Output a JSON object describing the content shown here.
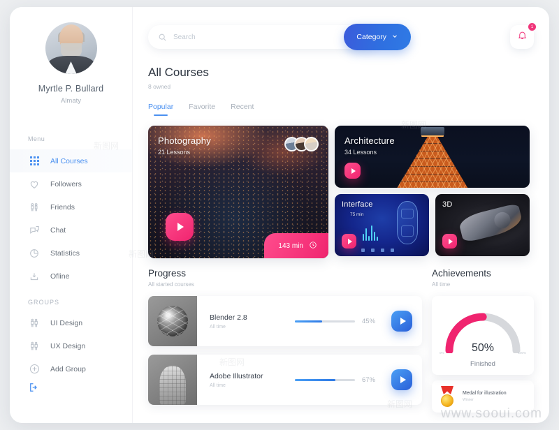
{
  "sidebar": {
    "user": {
      "name": "Myrtle P. Bullard",
      "city": "Almaty",
      "avatar_icon": "user-avatar"
    },
    "menu_label": "Menu",
    "items": [
      {
        "label": "All Courses",
        "icon": "grid-icon",
        "active": true
      },
      {
        "label": "Followers",
        "icon": "heart-icon",
        "active": false
      },
      {
        "label": "Friends",
        "icon": "friends-icon",
        "active": false
      },
      {
        "label": "Chat",
        "icon": "chat-icon",
        "active": false
      },
      {
        "label": "Statistics",
        "icon": "pie-chart-icon",
        "active": false
      },
      {
        "label": "Ofline",
        "icon": "download-icon",
        "active": false
      }
    ],
    "groups_label": "GROUPS",
    "groups": [
      {
        "label": "UI Design",
        "icon": "people-icon"
      },
      {
        "label": "UX Design",
        "icon": "people-icon"
      },
      {
        "label": "Add Group",
        "icon": "plus-circle-icon"
      }
    ],
    "logout_icon": "logout-icon"
  },
  "topbar": {
    "search": {
      "placeholder": "Search",
      "value": "",
      "icon": "search-icon"
    },
    "category_button": {
      "label": "Category",
      "icon": "chevron-down-icon"
    },
    "notifications": {
      "icon": "bell-icon",
      "badge": "1"
    }
  },
  "header": {
    "title": "All Courses",
    "subtitle": "8 owned",
    "tabs": [
      {
        "label": "Popular",
        "active": true
      },
      {
        "label": "Favorite",
        "active": false
      },
      {
        "label": "Recent",
        "active": false
      }
    ]
  },
  "courses": [
    {
      "title": "Photography",
      "lessons": "21 Lessons",
      "duration": "143 min",
      "play_icon": "play-icon",
      "clock_icon": "clock-icon"
    },
    {
      "title": "Architecture",
      "lessons": "34 Lessons",
      "play_icon": "play-icon"
    },
    {
      "title": "Interface",
      "lessons": "75 min",
      "play_icon": "play-icon"
    },
    {
      "title": "3D",
      "lessons": "",
      "play_icon": "play-icon"
    }
  ],
  "progress": {
    "title": "Progress",
    "subtitle": "All started courses",
    "rows": [
      {
        "name": "Blender 2.8",
        "time": "All time",
        "percent": "45%",
        "value": 45,
        "thumb": "blender-thumbnail",
        "play_icon": "play-icon"
      },
      {
        "name": "Adobe Illustrator",
        "time": "All time",
        "percent": "67%",
        "value": 67,
        "thumb": "bust-thumbnail",
        "play_icon": "play-icon"
      }
    ]
  },
  "achievements": {
    "title": "Achievements",
    "subtitle": "All time",
    "gauge": {
      "value": "50%",
      "percent": 50,
      "label": "Finished",
      "min": "0%",
      "max": "100%",
      "fill_color": "#f0246f",
      "track_color": "#d6d8dc"
    },
    "medal": {
      "name": "Medal for illustration",
      "subtitle": "Winner",
      "icon": "medal-icon"
    }
  },
  "watermarks": {
    "site": "www.sooui.com",
    "mark": "新图网"
  },
  "colors": {
    "accent_blue": "#2f7ae5",
    "accent_pink": "#f0246f",
    "text_dark": "#2e3641",
    "muted": "#b3bac3"
  }
}
